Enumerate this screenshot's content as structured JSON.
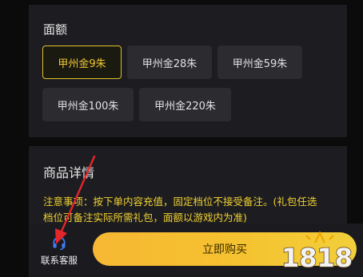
{
  "amount_section": {
    "title": "面额",
    "options": [
      {
        "label": "甲州金9朱",
        "selected": true
      },
      {
        "label": "甲州金28朱",
        "selected": false
      },
      {
        "label": "甲州金59朱",
        "selected": false
      },
      {
        "label": "甲州金100朱",
        "selected": false
      },
      {
        "label": "甲州金220朱",
        "selected": false
      }
    ]
  },
  "details_section": {
    "title": "商品详情",
    "notice_line1": "注意事项：按下单内容充值，固定档位不接受备注。(礼包任选",
    "notice_line2": "档位可备注实际所需礼包，面额以游戏内为准)"
  },
  "bottom_bar": {
    "customer_service_label": "联系客服",
    "customer_service_icon": "headset-icon",
    "buy_label": "立即购买"
  },
  "watermark": {
    "text": "1818"
  },
  "colors": {
    "accent_yellow": "#f0c830",
    "buy_gradient_start": "#f7b733",
    "arrow_red": "#e3262b",
    "icon_blue": "#3f7cf3"
  }
}
